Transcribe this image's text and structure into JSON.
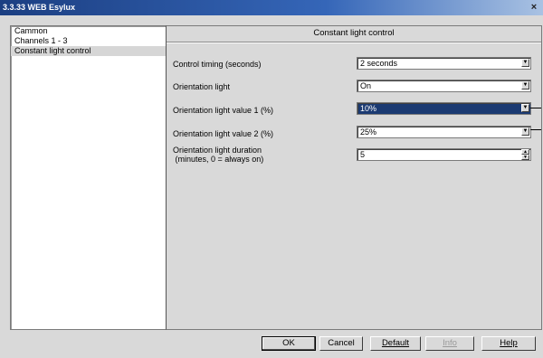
{
  "window": {
    "title": "3.3.33 WEB Esylux",
    "close_glyph": "×"
  },
  "sidebar": {
    "items": [
      {
        "label": "Cammon",
        "selected": false
      },
      {
        "label": "Channels 1 - 3",
        "selected": false
      },
      {
        "label": "Constant light control",
        "selected": true
      }
    ]
  },
  "panel": {
    "title": "Constant light control",
    "params": [
      {
        "label": "Control timing (seconds)",
        "value": "2 seconds",
        "control": "dropdown"
      },
      {
        "label": "Orientation light",
        "value": "On",
        "control": "dropdown"
      },
      {
        "label": "Orientation light value 1 (%)",
        "value": "10%",
        "control": "dropdown",
        "active": true
      },
      {
        "label": "Orientation light value 2 (%)",
        "value": "25%",
        "control": "dropdown"
      },
      {
        "label": "Orientation light duration\n(minutes, 0 = always on)",
        "label_line1": "Orientation light duration",
        "label_line2": " (minutes, 0 = always on)",
        "value": "5",
        "control": "spinner"
      }
    ]
  },
  "buttons": {
    "ok": "OK",
    "cancel": "Cancel",
    "default": "Default",
    "info": "Info",
    "help": "Help"
  },
  "icons": {
    "dropdown": "chevron-down-icon",
    "spinner_up": "spin-up-icon",
    "spinner_down": "spin-down-icon"
  },
  "colors": {
    "title_bar": "#1c3f82",
    "selection": "#1b3a72",
    "face": "#d9d9d9"
  }
}
